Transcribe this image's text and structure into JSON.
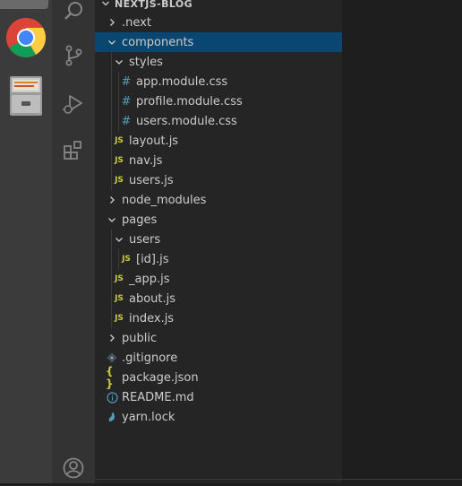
{
  "dock": {
    "items": [
      {
        "name": "chrome-icon"
      },
      {
        "name": "file-cabinet-icon"
      }
    ]
  },
  "activity_bar": {
    "icons": [
      "search-icon",
      "source-control-icon",
      "run-debug-icon",
      "extensions-icon",
      "accounts-icon"
    ]
  },
  "explorer": {
    "title": "NEXTJS-BLOG",
    "tree": [
      {
        "label": ".next",
        "type": "folder",
        "expanded": false,
        "depth": 0
      },
      {
        "label": "components",
        "type": "folder",
        "expanded": true,
        "depth": 0,
        "selected": true
      },
      {
        "label": "styles",
        "type": "folder",
        "expanded": true,
        "depth": 1
      },
      {
        "label": "app.module.css",
        "type": "css",
        "depth": 2
      },
      {
        "label": "profile.module.css",
        "type": "css",
        "depth": 2
      },
      {
        "label": "users.module.css",
        "type": "css",
        "depth": 2
      },
      {
        "label": "layout.js",
        "type": "js",
        "depth": 1
      },
      {
        "label": "nav.js",
        "type": "js",
        "depth": 1
      },
      {
        "label": "users.js",
        "type": "js",
        "depth": 1
      },
      {
        "label": "node_modules",
        "type": "folder",
        "expanded": false,
        "depth": 0
      },
      {
        "label": "pages",
        "type": "folder",
        "expanded": true,
        "depth": 0
      },
      {
        "label": "users",
        "type": "folder",
        "expanded": true,
        "depth": 1
      },
      {
        "label": "[id].js",
        "type": "js",
        "depth": 2
      },
      {
        "label": "_app.js",
        "type": "js",
        "depth": 1
      },
      {
        "label": "about.js",
        "type": "js",
        "depth": 1
      },
      {
        "label": "index.js",
        "type": "js",
        "depth": 1
      },
      {
        "label": "public",
        "type": "folder",
        "expanded": false,
        "depth": 0
      },
      {
        "label": ".gitignore",
        "type": "git",
        "depth": 0
      },
      {
        "label": "package.json",
        "type": "json",
        "depth": 0
      },
      {
        "label": "README.md",
        "type": "info",
        "depth": 0
      },
      {
        "label": "yarn.lock",
        "type": "yarn",
        "depth": 0
      }
    ],
    "icon_glyphs": {
      "css": "#",
      "js": "JS",
      "json": "{ }"
    }
  },
  "colors": {
    "selection": "#094771",
    "css_icon": "#519aba",
    "js_icon": "#cbcb41",
    "text": "#cccccc"
  }
}
